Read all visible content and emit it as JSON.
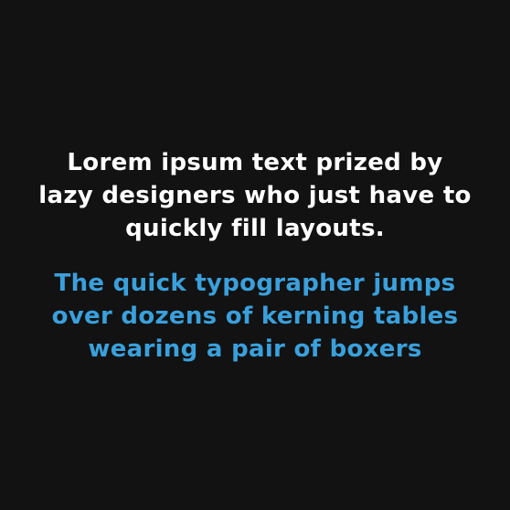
{
  "colors": {
    "background": "#121212",
    "primary_text": "#ffffff",
    "accent_text": "#3aa0dc"
  },
  "white_text": {
    "lines": [
      "Lorem ipsum text prized by",
      "lazy designers who just have to",
      "quickly fill layouts."
    ]
  },
  "blue_text": {
    "lines": [
      "The quick typographer jumps",
      "over dozens of kerning tables",
      "wearing a pair of boxers"
    ]
  }
}
